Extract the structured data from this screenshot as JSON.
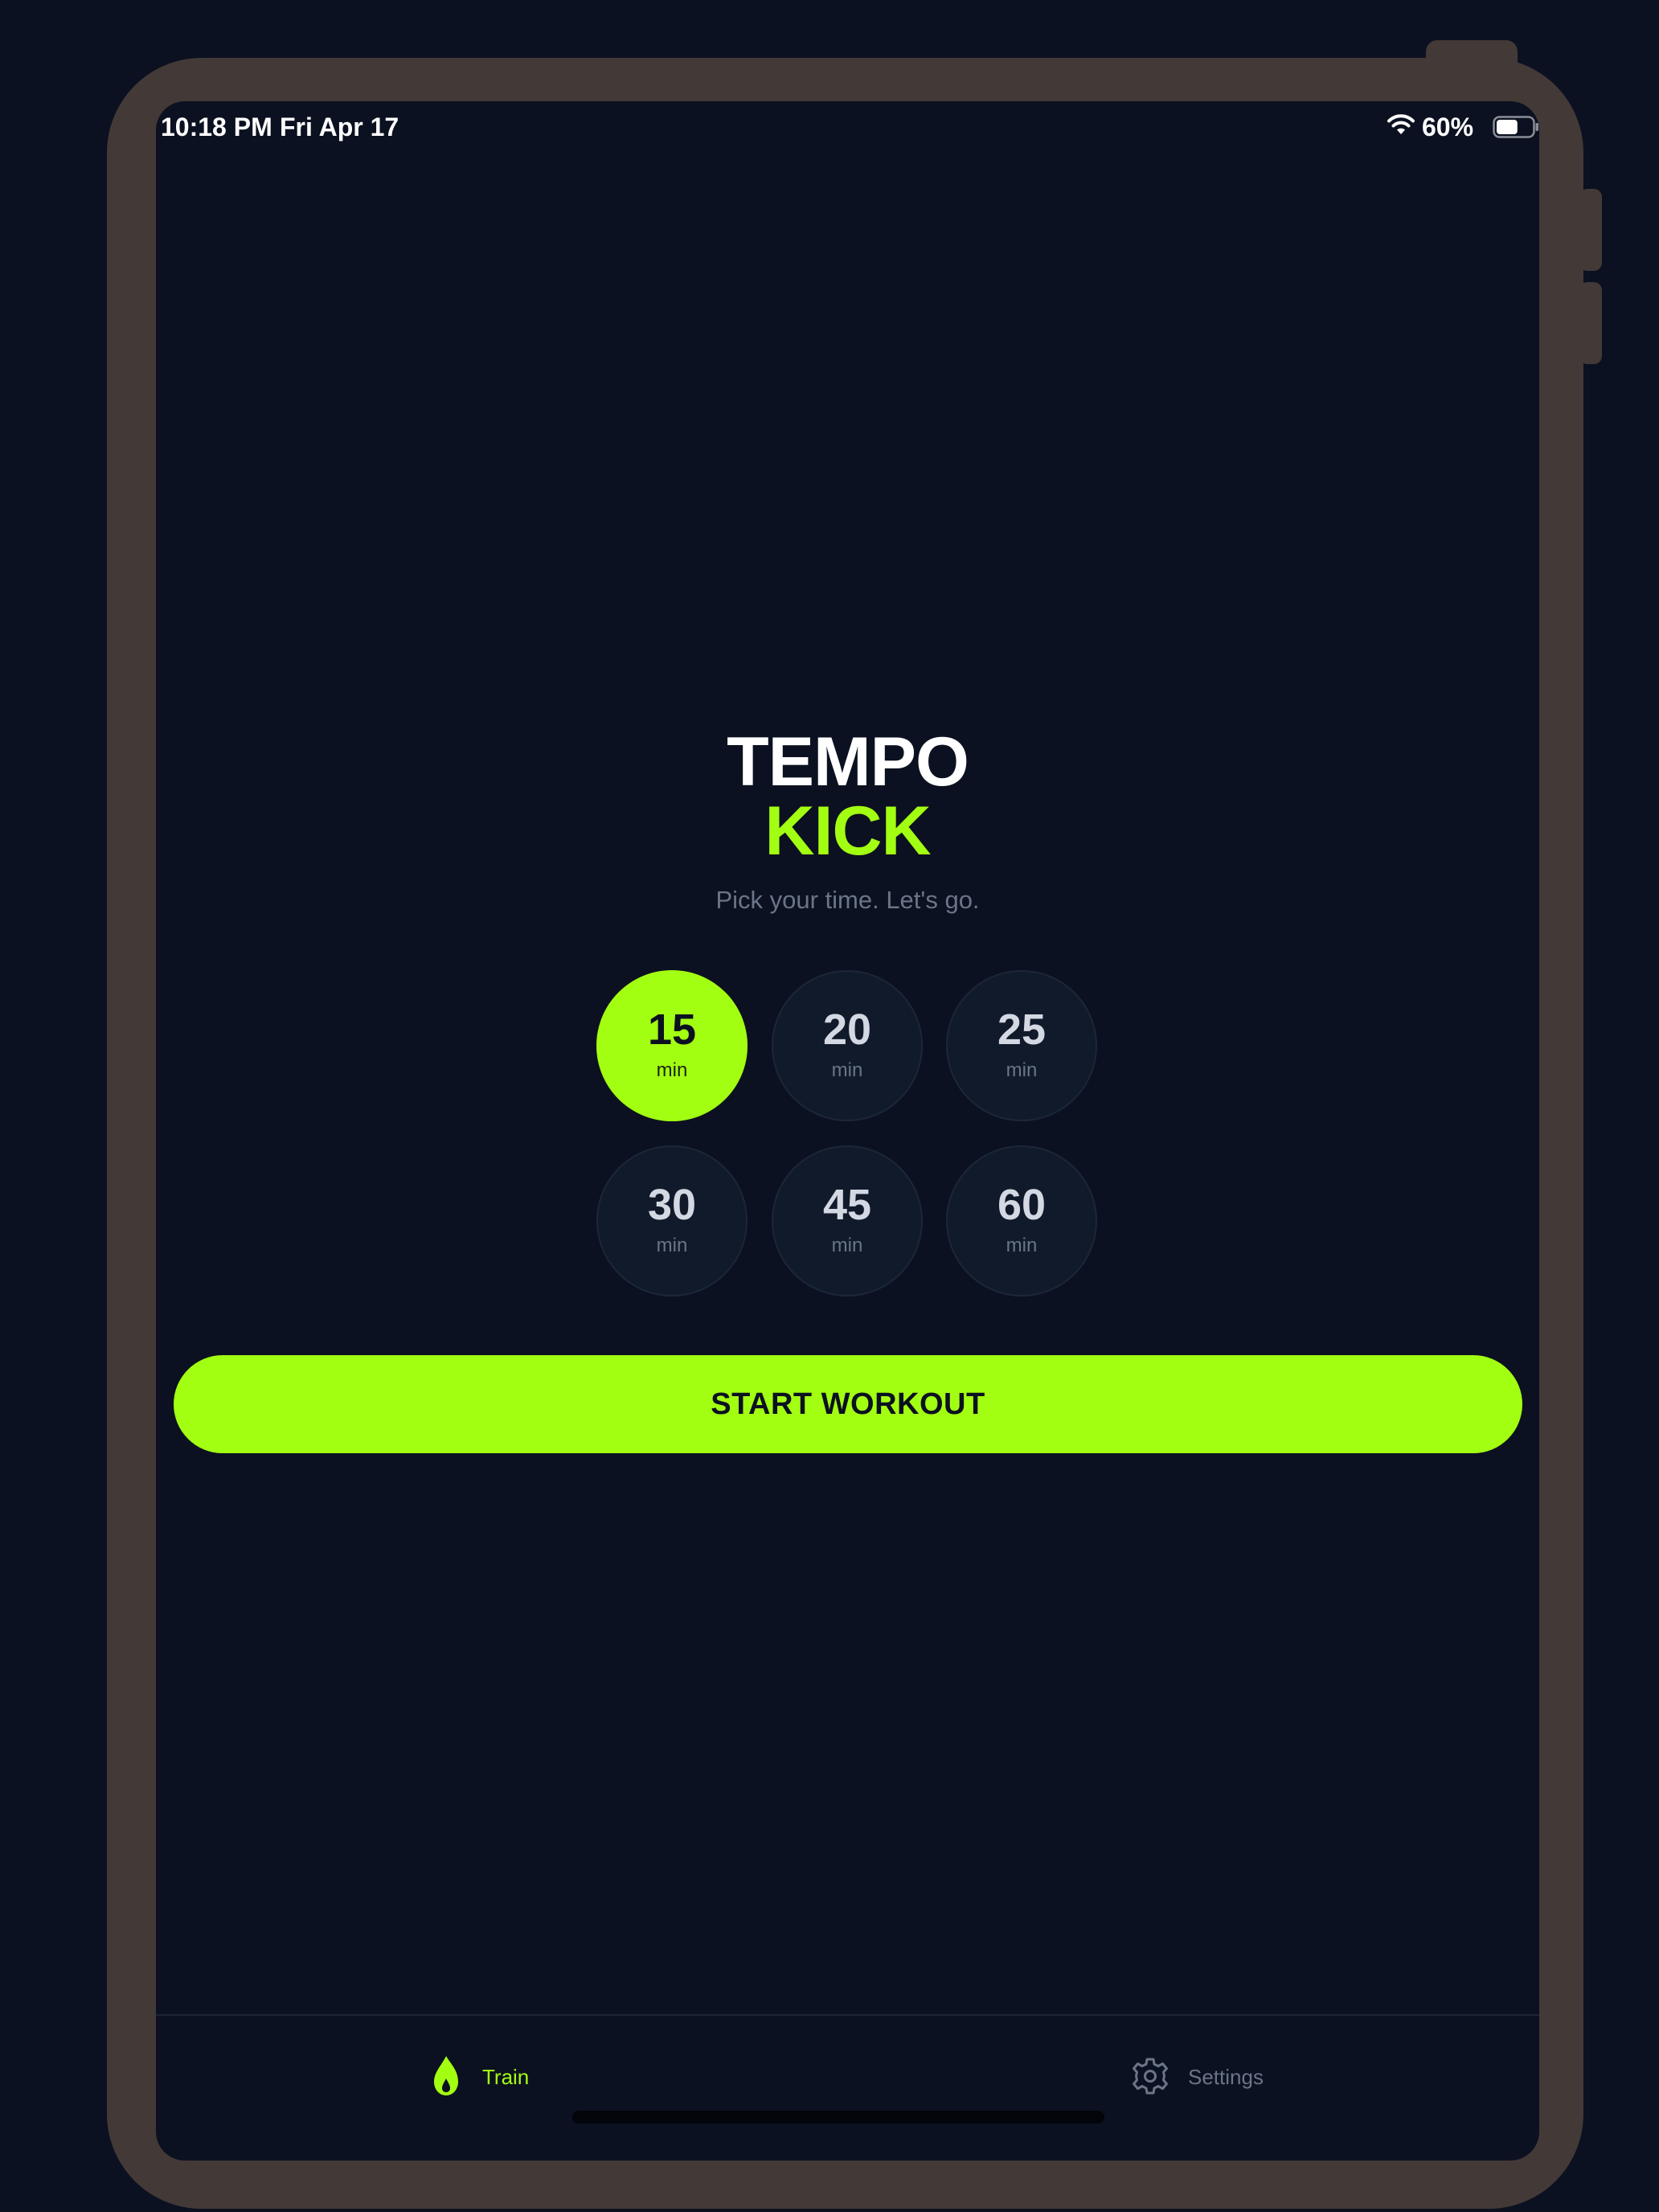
{
  "status_bar": {
    "time": "10:18 PM",
    "date": "Fri Apr 17",
    "battery_percent": "60%",
    "battery_level": 0.6,
    "icons": [
      "wifi-icon",
      "battery-icon"
    ]
  },
  "app": {
    "title_line1": "TEMPO",
    "title_line2": "KICK",
    "tagline": "Pick your time. Let's go.",
    "accent_color": "#a3ff12",
    "background_color": "#0b1120"
  },
  "durations": [
    {
      "value": "15",
      "unit": "min",
      "selected": true
    },
    {
      "value": "20",
      "unit": "min",
      "selected": false
    },
    {
      "value": "25",
      "unit": "min",
      "selected": false
    },
    {
      "value": "30",
      "unit": "min",
      "selected": false
    },
    {
      "value": "45",
      "unit": "min",
      "selected": false
    },
    {
      "value": "60",
      "unit": "min",
      "selected": false
    }
  ],
  "start_button_label": "START WORKOUT",
  "tab_bar": {
    "tabs": [
      {
        "label": "Train",
        "icon": "flame-icon",
        "active": true
      },
      {
        "label": "Settings",
        "icon": "gear-icon",
        "active": false
      }
    ]
  }
}
